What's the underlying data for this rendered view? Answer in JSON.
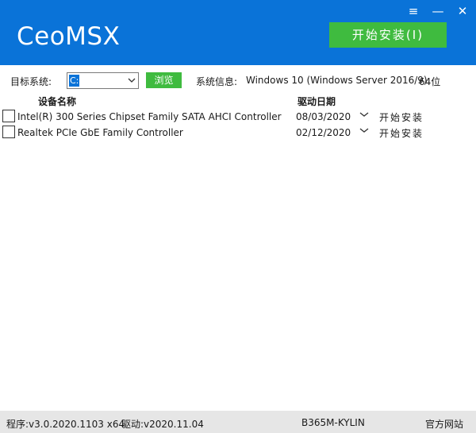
{
  "app": {
    "logo": "CeoMSX"
  },
  "window": {
    "menu_icon": "≡",
    "minimize_icon": "—",
    "close_icon": "✕"
  },
  "header": {
    "install_all_label": "开始安装(I)"
  },
  "toolbar": {
    "os_label": "目标系统:",
    "os_value": "C:",
    "browse_label": "浏览",
    "sysinfo_label": "系统信息:",
    "sysinfo_value": "Windows 10 (Windows Server 2016/9)",
    "bits": "64位"
  },
  "table": {
    "headers": {
      "device": "设备名称",
      "date": "驱动日期"
    },
    "rows": [
      {
        "device": "Intel(R) 300 Series Chipset Family SATA AHCI Controller",
        "date": "08/03/2020",
        "install": "开始安装",
        "checked": false
      },
      {
        "device": "Realtek PCIe GbE Family Controller",
        "date": "02/12/2020",
        "install": "开始安装",
        "checked": false
      }
    ]
  },
  "footer": {
    "version": "程序:v3.0.2020.1103 x64",
    "driver": "驱动:v2020.11.04",
    "board": "B365M-KYLIN",
    "site": "官方网站"
  },
  "colors": {
    "header_blue": "#0a73d8",
    "button_green": "#3fbb3f",
    "footer_gray": "#e6e6e6"
  }
}
